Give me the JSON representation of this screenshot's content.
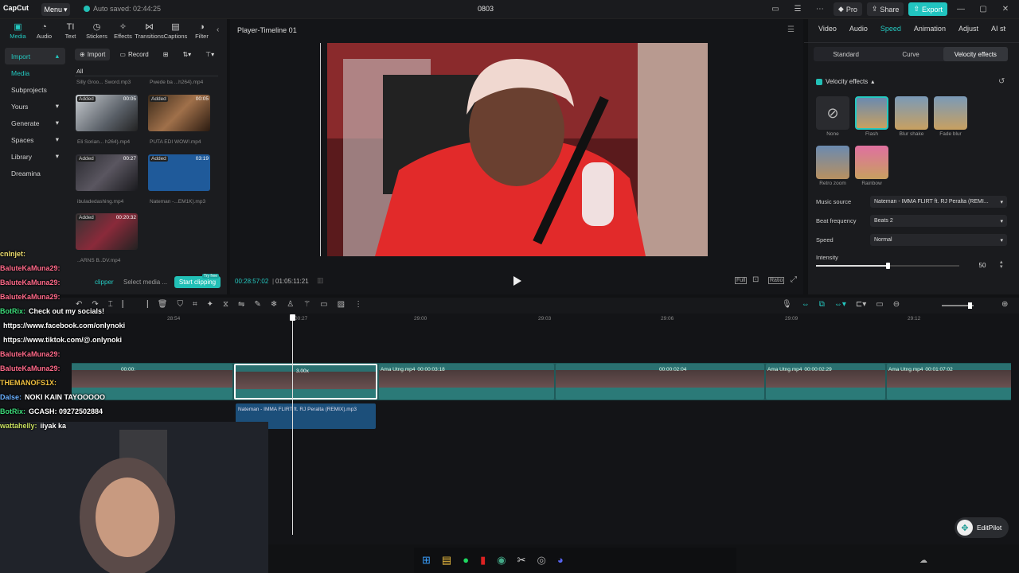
{
  "app": {
    "logo": "CapCut",
    "menu": "Menu",
    "autosave": "Auto saved: 02:44:25",
    "title": "0803"
  },
  "top_right": {
    "pro": "Pro",
    "share": "Share",
    "export": "Export"
  },
  "tools": [
    {
      "label": "Media",
      "icon": "media-icon"
    },
    {
      "label": "Audio",
      "icon": "audio-icon"
    },
    {
      "label": "Text",
      "icon": "text-icon"
    },
    {
      "label": "Stickers",
      "icon": "stickers-icon"
    },
    {
      "label": "Effects",
      "icon": "effects-icon"
    },
    {
      "label": "Transitions",
      "icon": "transitions-icon"
    },
    {
      "label": "Captions",
      "icon": "captions-icon"
    },
    {
      "label": "Filter",
      "icon": "filter-icon"
    }
  ],
  "sidebar": [
    {
      "label": "Import"
    },
    {
      "label": "Media"
    },
    {
      "label": "Subprojects"
    },
    {
      "label": "Yours"
    },
    {
      "label": "Generate"
    },
    {
      "label": "Spaces"
    },
    {
      "label": "Library"
    },
    {
      "label": "Dreamina"
    }
  ],
  "media_header": {
    "import": "Import",
    "record": "Record",
    "all": "All"
  },
  "media_top_captions": [
    "Silly Groo... Sword.mp3",
    "Pwede ba ...h264).mp4"
  ],
  "media_items": [
    {
      "badge": "Added",
      "duration": "00:05",
      "caption": "Eli Sorian... h264).mp4"
    },
    {
      "badge": "Added",
      "duration": "00:05",
      "caption": "PUTA EDI WOW!.mp4"
    },
    {
      "badge": "Added",
      "duration": "00:27",
      "caption": "ibuladedashing.mp4"
    },
    {
      "badge": "Added",
      "duration": "03:19",
      "caption": "Nateman -...EM1K).mp3"
    },
    {
      "badge": "Added",
      "duration": "00:20:32",
      "caption": "..ARNS B..DV.mp4"
    }
  ],
  "clipper": {
    "label": "clipper",
    "select": "Select media ...",
    "start": "Start clipping",
    "try": "Try free"
  },
  "player": {
    "title": "Player-Timeline 01",
    "current": "00:28:57:02",
    "total": "01:05:11:21",
    "full": "Full",
    "ratio": "Ratio"
  },
  "right_tabs": [
    "Video",
    "Audio",
    "Speed",
    "Animation",
    "Adjust",
    "AI st"
  ],
  "speed_tabs": [
    "Standard",
    "Curve",
    "Velocity effects"
  ],
  "velocity": {
    "header": "Velocity effects",
    "effects": [
      "None",
      "Flash",
      "Blur shake",
      "Fade blur",
      "Retro zoom",
      "Rainbow"
    ],
    "music_source_label": "Music source",
    "music_source": "Nateman - IMMA FLIRT ft. RJ Peralta (REMI...",
    "beat_label": "Beat frequency",
    "beat": "Beats 2",
    "speed_label": "Speed",
    "speed": "Normal",
    "intensity_label": "Intensity",
    "intensity": "50",
    "intensity_fraction": 0.5
  },
  "ruler": [
    "28:54",
    "29:00",
    "29:03",
    "29:06",
    "29:09",
    "29:12",
    "00:27"
  ],
  "clips": [
    {
      "label": "Ama Utng.mp4",
      "time": "00:00:"
    },
    {
      "label": "Ama Utng.mp4",
      "time": "00:00:03:18"
    },
    {
      "label": "Ama Utng.mp4",
      "time": "00:00:02:04"
    },
    {
      "label": "Ama Utng.mp4",
      "time": "00:00:02:29"
    },
    {
      "label": "Ama Utng.mp4",
      "time": "00:01:07:02"
    }
  ],
  "selected_clip_speed": "3.00x",
  "audio_clip": "Nateman - IMMA FLIRT ft. RJ Peralta (REMIX).mp3",
  "chat": [
    {
      "name": "cnlnjet:",
      "msg": "",
      "color": "#f0e070"
    },
    {
      "name": "BaluteKaMuna29:",
      "msg": "",
      "color": "#ff6a8a"
    },
    {
      "name": "BaluteKaMuna29:",
      "msg": "",
      "color": "#ff6a8a"
    },
    {
      "name": "BaluteKaMuna29:",
      "msg": "",
      "color": "#ff6a8a"
    },
    {
      "name": "BotRix:",
      "msg": "Check out my socials!",
      "color": "#3cdc7a"
    },
    {
      "name": "",
      "msg": "https://www.facebook.com/onlynoki",
      "color": "#fff"
    },
    {
      "name": "",
      "msg": "https://www.tiktok.com/@.onlynoki",
      "color": "#fff"
    },
    {
      "name": "BaluteKaMuna29:",
      "msg": "",
      "color": "#ff6a8a"
    },
    {
      "name": "BaluteKaMuna29:",
      "msg": "",
      "color": "#ff6a8a"
    },
    {
      "name": "THEMANOFS1X:",
      "msg": "",
      "color": "#f0c040"
    },
    {
      "name": "Dalse:",
      "msg": "NOKI KAIN TAYOOOOO",
      "color": "#6ab0ff"
    },
    {
      "name": "BotRix:",
      "msg": "GCASH: 09272502884",
      "color": "#3cdc7a"
    },
    {
      "name": "wattahelly:",
      "msg": "iiyak ka",
      "color": "#c8e060"
    }
  ],
  "editpilot": "EditPilot"
}
